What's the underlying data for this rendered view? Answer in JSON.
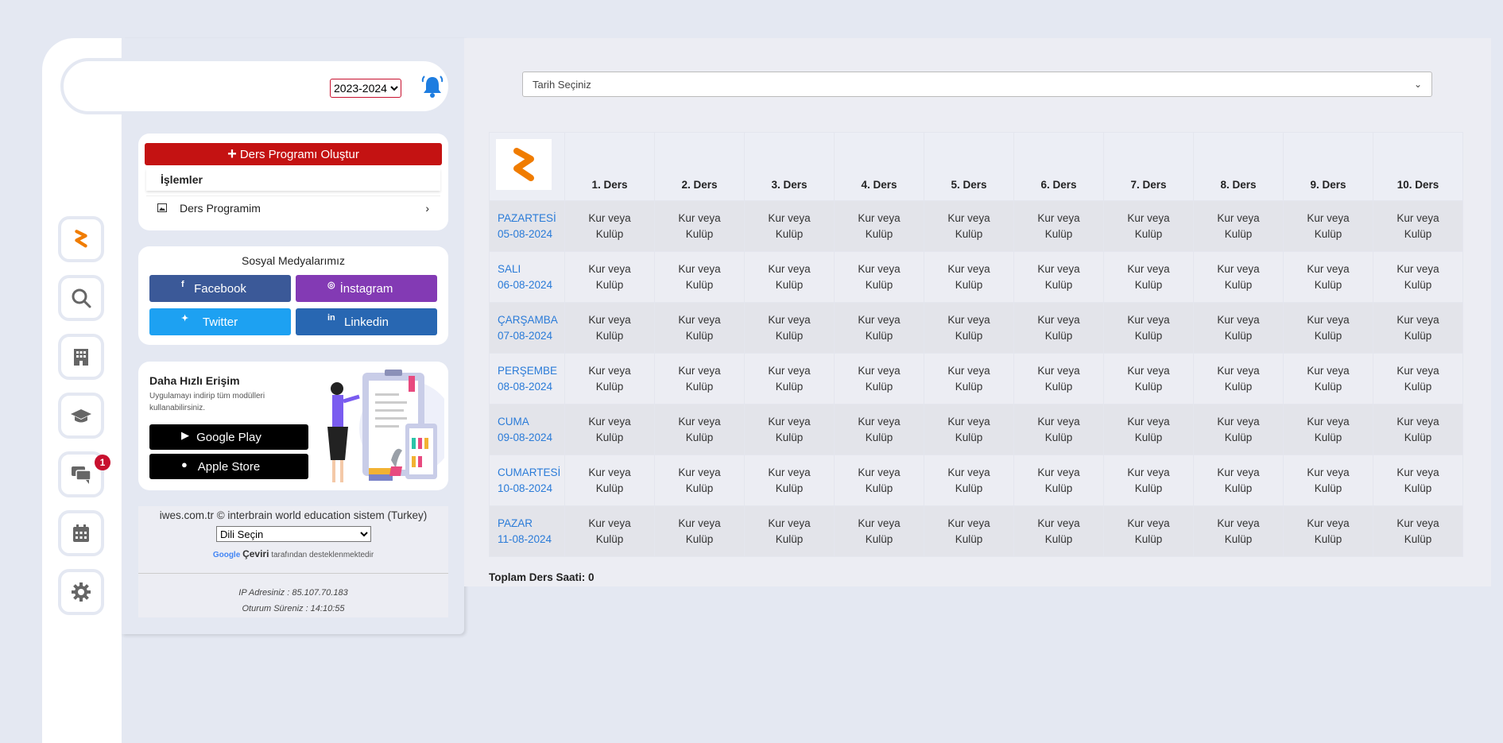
{
  "header": {
    "year_select": "2023-2024"
  },
  "sidebar": {
    "items": [
      {
        "icon": "logo-icon"
      },
      {
        "icon": "search-icon"
      },
      {
        "icon": "building-icon"
      },
      {
        "icon": "graduation-cap-icon"
      },
      {
        "icon": "chat-icon",
        "badge": "1"
      },
      {
        "icon": "calendar-icon"
      },
      {
        "icon": "gear-icon"
      }
    ]
  },
  "program_card": {
    "create_label": "Ders Programı Oluştur",
    "menu_title": "İşlemler",
    "menu_item": "Ders Programim"
  },
  "social": {
    "title": "Sosyal Medyalarımız",
    "facebook": "Facebook",
    "instagram": "İnstagram",
    "twitter": "Twitter",
    "linkedin": "Linkedin"
  },
  "app_promo": {
    "title": "Daha Hızlı Erişim",
    "desc": "Uygulamayı indirip tüm modülleri kullanabilirsiniz.",
    "google_play": "Google Play",
    "apple_store": "Apple Store"
  },
  "footer": {
    "copyright": "iwes.com.tr © interbrain world education sistem (Turkey)",
    "language_select": "Dili Seçin",
    "powered_google": "Google",
    "powered_ceviri": "Çeviri",
    "powered_rest": "tarafından desteklenmektedir",
    "ip": "IP Adresiniz : 85.107.70.183",
    "session": "Oturum Süreniz : 14:10:55"
  },
  "main": {
    "date_select": "Tarih Seçiniz",
    "columns": [
      "1. Ders",
      "2. Ders",
      "3. Ders",
      "4. Ders",
      "5. Ders",
      "6. Ders",
      "7. Ders",
      "8. Ders",
      "9. Ders",
      "10. Ders"
    ],
    "rows": [
      {
        "day": "PAZARTESİ",
        "date": "05-08-2024"
      },
      {
        "day": "SALI",
        "date": "06-08-2024"
      },
      {
        "day": "ÇARŞAMBA",
        "date": "07-08-2024"
      },
      {
        "day": "PERŞEMBE",
        "date": "08-08-2024"
      },
      {
        "day": "CUMA",
        "date": "09-08-2024"
      },
      {
        "day": "CUMARTESİ",
        "date": "10-08-2024"
      },
      {
        "day": "PAZAR",
        "date": "11-08-2024"
      }
    ],
    "cell_line1": "Kur veya",
    "cell_line2": "Kulüp",
    "total_label": "Toplam Ders Saati: 0"
  },
  "colors": {
    "accent_red": "#c41212",
    "brand_orange": "#f07c00",
    "link_blue": "#2a7bd8",
    "bell_blue": "#1e7de0"
  }
}
